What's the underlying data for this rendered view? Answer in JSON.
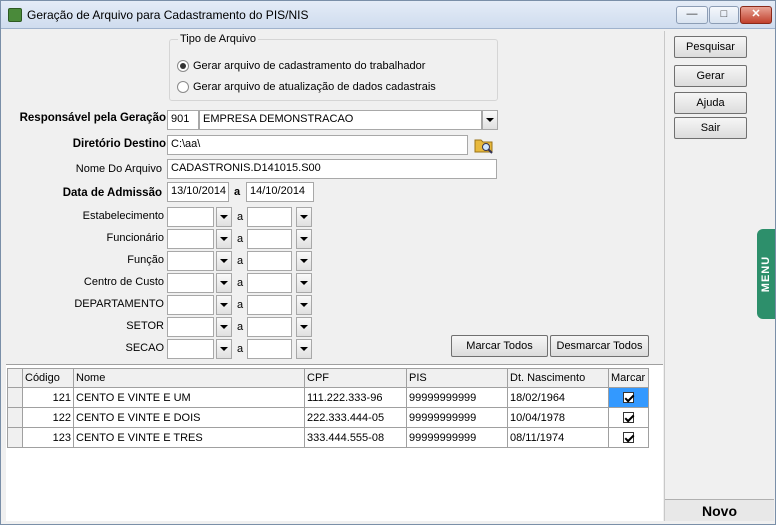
{
  "window": {
    "title": "Geração de Arquivo para Cadastramento do PIS/NIS",
    "min": "—",
    "max": "□",
    "close": "✕"
  },
  "tipo_arquivo": {
    "legend": "Tipo de Arquivo",
    "options": [
      "Gerar arquivo de cadastramento do trabalhador",
      "Gerar arquivo de atualização de dados cadastrais"
    ],
    "selected": 0
  },
  "form": {
    "responsavel": {
      "label": "Responsável pela Geração",
      "code": "901",
      "name": "EMPRESA DEMONSTRACAO"
    },
    "diretorio": {
      "label": "Diretório Destino",
      "value": "C:\\aa\\"
    },
    "nome_arquivo": {
      "label": "Nome Do Arquivo",
      "value": "CADASTRONIS.D141015.S00"
    },
    "data_admissao": {
      "label": "Data de Admissão",
      "from": "13/10/2014",
      "sep": "a",
      "to": "14/10/2014"
    },
    "ranges": [
      {
        "label": "Estabelecimento",
        "sep": "a"
      },
      {
        "label": "Funcionário",
        "sep": "a"
      },
      {
        "label": "Função",
        "sep": "a"
      },
      {
        "label": "Centro de Custo",
        "sep": "a"
      },
      {
        "label": "DEPARTAMENTO",
        "sep": "a"
      },
      {
        "label": "SETOR",
        "sep": "a"
      },
      {
        "label": "SECAO",
        "sep": "a"
      }
    ]
  },
  "buttons": {
    "marcar_todos": "Marcar Todos",
    "desmarcar_todos": "Desmarcar Todos"
  },
  "side": {
    "pesquisar": "Pesquisar",
    "gerar": "Gerar",
    "ajuda": "Ajuda",
    "sair": "Sair",
    "menu": "MENU",
    "status": "Novo"
  },
  "grid": {
    "columns": [
      "Código",
      "Nome",
      "CPF",
      "PIS",
      "Dt. Nascimento",
      "Marcar"
    ],
    "rows": [
      {
        "codigo": "121",
        "nome": "CENTO E VINTE E UM",
        "cpf": "111.222.333-96",
        "pis": "99999999999",
        "nasc": "18/02/1964",
        "marcar": true
      },
      {
        "codigo": "122",
        "nome": "CENTO E VINTE E DOIS",
        "cpf": "222.333.444-05",
        "pis": "99999999999",
        "nasc": "10/04/1978",
        "marcar": true
      },
      {
        "codigo": "123",
        "nome": "CENTO E VINTE E TRES",
        "cpf": "333.444.555-08",
        "pis": "99999999999",
        "nasc": "08/11/1974",
        "marcar": true
      }
    ]
  },
  "colors": {
    "menu_tab": "#2d8f6b",
    "selection": "#3399ff"
  }
}
